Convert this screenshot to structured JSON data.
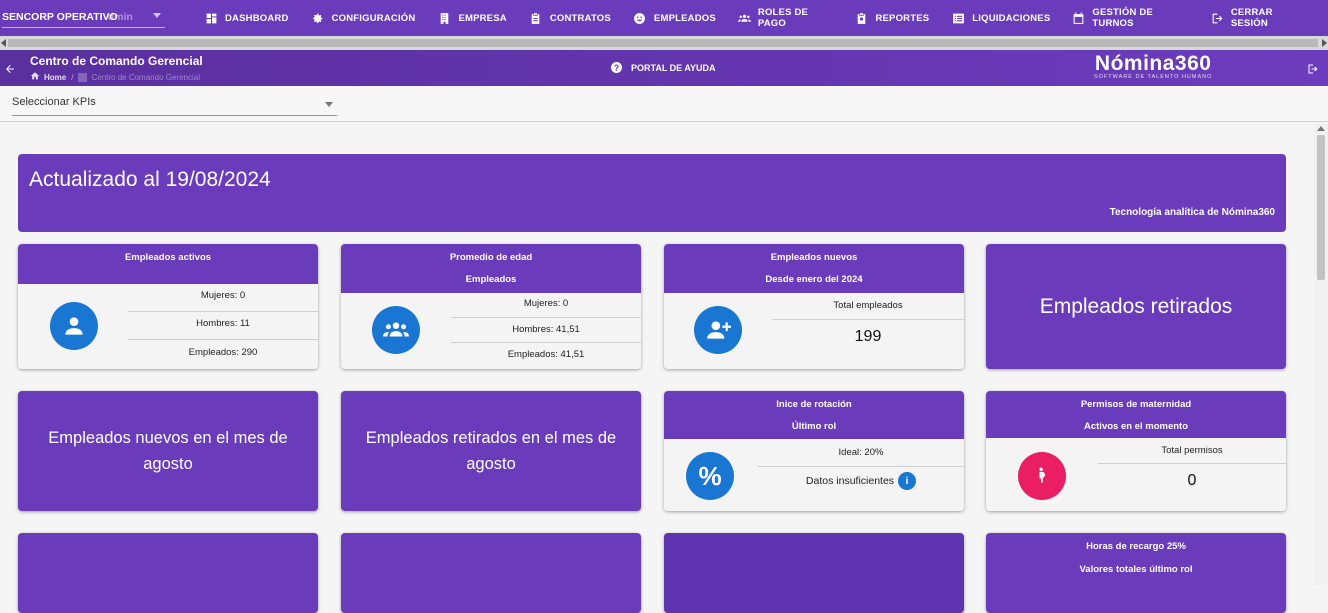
{
  "topnav": {
    "company": "SENCORP OPERATIVO",
    "company_ghost": "dmin",
    "items": [
      {
        "label": "DASHBOARD",
        "icon": "dashboard-icon"
      },
      {
        "label": "CONFIGURACIÓN",
        "icon": "gear-icon"
      },
      {
        "label": "EMPRESA",
        "icon": "building-icon"
      },
      {
        "label": "CONTRATOS",
        "icon": "clipboard-icon"
      },
      {
        "label": "EMPLEADOS",
        "icon": "face-icon"
      },
      {
        "label": "ROLES DE PAGO",
        "icon": "users-icon"
      },
      {
        "label": "REPORTES",
        "icon": "report-icon"
      },
      {
        "label": "LIQUIDACIONES",
        "icon": "list-icon"
      },
      {
        "label": "GESTIÓN DE TURNOS",
        "icon": "calendar-icon"
      },
      {
        "label": "CERRAR SESIÓN",
        "icon": "logout-icon"
      }
    ]
  },
  "header": {
    "title": "Centro de Comando Gerencial",
    "breadcrumb_home": "Home",
    "breadcrumb_current": "Centro de Comando Gerencial",
    "help": "PORTAL DE AYUDA",
    "brand": "Nómina360",
    "brand_tag": "SOFTWARE DE TALENTO HUMANO"
  },
  "kpi": {
    "placeholder": "Seleccionar KPIs"
  },
  "banner": {
    "title": "Actualizado al 19/08/2024",
    "subtitle": "Tecnología analítica de Nómina360"
  },
  "cards": {
    "activos": {
      "title": "Empleados activos",
      "mujeres": "Mujeres: 0",
      "hombres": "Hombres: 11",
      "empleados": "Empleados: 290"
    },
    "edad": {
      "title": "Promedio de edad",
      "subtitle": "Empleados",
      "mujeres": "Mujeres: 0",
      "hombres": "Hombres: 41,51",
      "empleados": "Empleados: 41,51"
    },
    "nuevos": {
      "title": "Empleados nuevos",
      "subtitle": "Desde enero del 2024",
      "label": "Total empleados",
      "value": "199"
    },
    "retirados": {
      "label": "Empleados retirados"
    },
    "nuevos_mes": {
      "label": "Empleados nuevos en el mes de agosto"
    },
    "retirados_mes": {
      "label": "Empleados retirados en el mes de agosto"
    },
    "rotacion": {
      "title": "Inice de rotación",
      "subtitle": "Último rol",
      "ideal": "Ideal: 20%",
      "datos": "Datos insuficientes",
      "symbol": "%"
    },
    "maternidad": {
      "title": "Permisos de maternidad",
      "subtitle": "Activos en el momento",
      "label": "Total permisos",
      "value": "0"
    },
    "recargo": {
      "title": "Horas de recargo 25%",
      "subtitle": "Valores totales último rol"
    }
  },
  "colors": {
    "primary": "#6a3cbc",
    "blue": "#1976d2",
    "pink": "#e91e63"
  }
}
